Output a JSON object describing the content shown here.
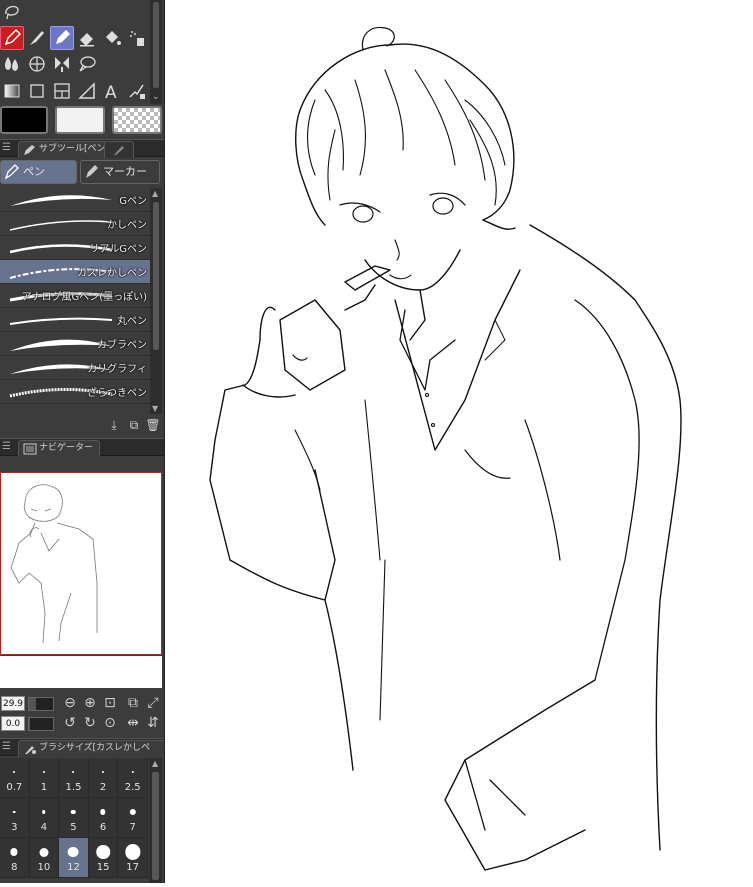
{
  "toolbar": {
    "tools_row1": [
      "pen-tool-icon",
      "brush-tool-icon",
      "pen-pressure-icon",
      "eraser-icon",
      "fill-icon",
      "airbrush-icon"
    ],
    "tools_row2": [
      "blend-icon",
      "mesh-icon",
      "figure-icon",
      "lasso-icon"
    ],
    "tools_row3": [
      "gradient-icon",
      "rect-select-icon",
      "frame-icon",
      "ruler-icon",
      "text-icon",
      "operation-icon"
    ]
  },
  "colors": {
    "main": "#000000",
    "sub": "#f2f2f2",
    "accent_selected": "#67728e",
    "nav_frame": "#d21414"
  },
  "subtool_panel": {
    "tab_label": "サブツール[ペン]",
    "groups": [
      {
        "label": "ペン",
        "active": true
      },
      {
        "label": "マーカー",
        "active": false
      }
    ],
    "brushes": [
      {
        "label": "Gペン",
        "selected": false
      },
      {
        "label": "かしペン",
        "selected": false
      },
      {
        "label": "リアルGペン",
        "selected": false
      },
      {
        "label": "カスレかしペン",
        "selected": true
      },
      {
        "label": "アナログ風Gペン(墨っぽい)",
        "selected": false
      },
      {
        "label": "丸ペン",
        "selected": false
      },
      {
        "label": "カブラペン",
        "selected": false
      },
      {
        "label": "カリグラフィ",
        "selected": false
      },
      {
        "label": "ざらつきペン",
        "selected": false
      }
    ]
  },
  "navigator": {
    "tab_label": "ナビゲーター",
    "zoom": "29.9",
    "rotation": "0.0"
  },
  "brush_size_panel": {
    "tab_label": "ブラシサイズ[カスレかしペン]",
    "sizes": [
      "0.7",
      "1",
      "1.5",
      "2",
      "2.5",
      "3",
      "4",
      "5",
      "6",
      "7",
      "8",
      "10",
      "12",
      "15",
      "17"
    ],
    "selected": "12"
  }
}
